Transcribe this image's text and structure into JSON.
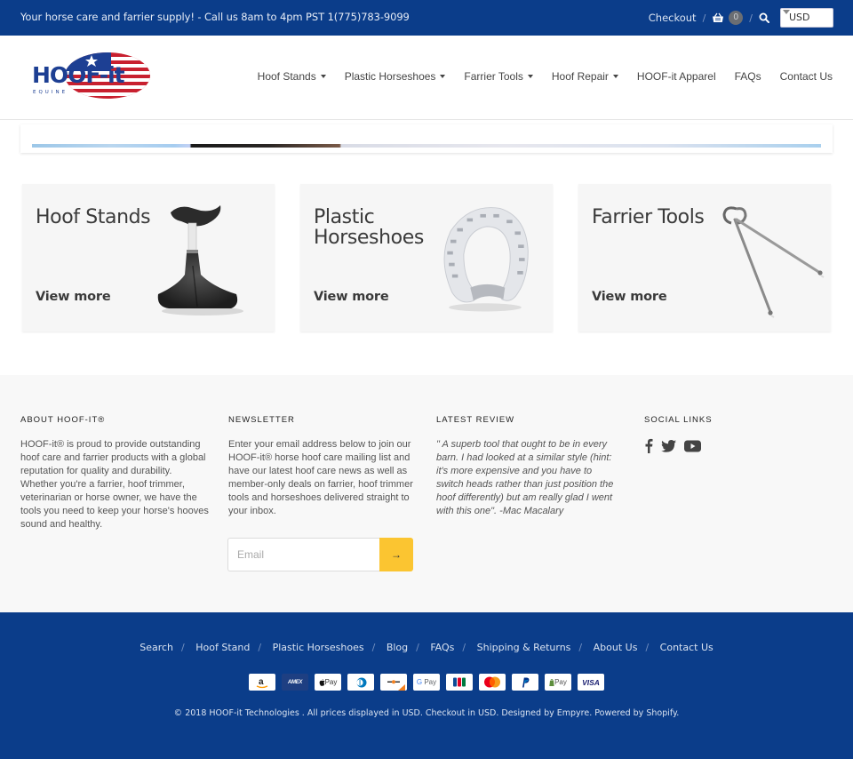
{
  "topbar": {
    "announcement": "Your horse care and farrier supply! - Call us 8am to 4pm PST 1(775)783-9099",
    "checkout_label": "Checkout",
    "separator": "/",
    "cart_count": "0",
    "currency": "USD",
    "icons": {
      "cart": "basket-icon",
      "search": "search-icon"
    }
  },
  "header": {
    "logo_text": "HOOF-it",
    "logo_subtext": "EQUINE",
    "nav": [
      {
        "label": "Hoof Stands",
        "dropdown": true
      },
      {
        "label": "Plastic Horseshoes",
        "dropdown": true
      },
      {
        "label": "Farrier Tools",
        "dropdown": true
      },
      {
        "label": "Hoof Repair",
        "dropdown": true
      },
      {
        "label": "HOOF-it Apparel",
        "dropdown": false
      },
      {
        "label": "FAQs",
        "dropdown": false
      },
      {
        "label": "Contact Us",
        "dropdown": false
      }
    ]
  },
  "categories": [
    {
      "title_line1": "Hoof Stands",
      "title_line2": "",
      "cta": "View more",
      "image": "hoof-stand-image"
    },
    {
      "title_line1": "Plastic",
      "title_line2": "Horseshoes",
      "cta": "View more",
      "image": "plastic-horseshoe-image"
    },
    {
      "title_line1": "Farrier Tools",
      "title_line2": "",
      "cta": "View more",
      "image": "farrier-pincers-image"
    }
  ],
  "footer": {
    "about": {
      "heading": "ABOUT HOOF-IT®",
      "text": "HOOF-it® is proud to provide outstanding hoof care and farrier products with a global reputation for quality and durability. Whether you're a farrier, hoof trimmer, veterinarian or horse owner, we have the tools you need to keep your horse's hooves sound and healthy."
    },
    "newsletter": {
      "heading": "NEWSLETTER",
      "text": "Enter your email address below to join our HOOF-it® horse hoof care mailing list and have our latest hoof care news as well as member-only deals on farrier, hoof trimmer tools and horseshoes delivered straight to your inbox.",
      "email_placeholder": "Email",
      "email_value": "",
      "submit_label": "→"
    },
    "review": {
      "heading": "LATEST REVIEW",
      "text": "\" A superb tool that ought to be in every barn. I had looked at a similar style (hint: it's more expensive and you have to switch heads rather than just position the hoof differently) but am really glad I went with this one\".  -Mac Macalary"
    },
    "social": {
      "heading": "SOCIAL LINKS",
      "icons": [
        "facebook-icon",
        "twitter-icon",
        "youtube-icon"
      ]
    }
  },
  "bottombar": {
    "links": [
      "Search",
      "Hoof Stand",
      "Plastic Horseshoes",
      "Blog",
      "FAQs",
      "Shipping & Returns",
      "About Us",
      "Contact Us"
    ],
    "separator": "/",
    "payments": [
      "Amazon",
      "American Express",
      "Apple Pay",
      "Diners Club",
      "Discover",
      "Google Pay",
      "JCB",
      "Mastercard",
      "PayPal",
      "Shopify Pay",
      "Visa"
    ],
    "copyright": "© 2018 HOOF-it Technologies . All prices displayed in USD. Checkout in USD. Designed by Empyre. Powered by Shopify."
  },
  "colors": {
    "brand_blue": "#0b3d8a",
    "accent_yellow": "#fbc531",
    "footer_bg": "#f8f8f8",
    "card_bg": "#f6f6f6"
  }
}
